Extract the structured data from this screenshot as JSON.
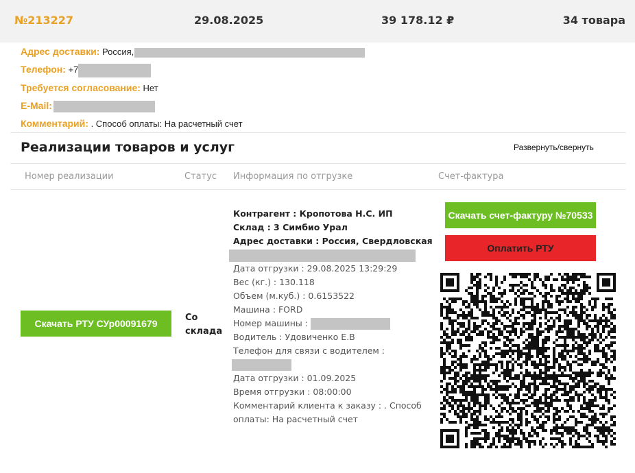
{
  "order": {
    "number": "№213227",
    "date": "29.08.2025",
    "sum": "39 178.12 ₽",
    "count": "34 товара"
  },
  "info": {
    "address_label": "Адрес доставки:",
    "address_value": "Россия,",
    "phone_label": "Телефон:",
    "phone_value": "+7",
    "approval_label": "Требуется согласование:",
    "approval_value": "Нет",
    "email_label": "E-Mail:",
    "comment_label": "Комментарий:",
    "comment_value": ". Способ оплаты: На расчетный счет"
  },
  "section": {
    "title": "Реализации товаров и услуг",
    "toggle": "Развернуть/свернуть"
  },
  "table": {
    "headers": [
      "Номер реализации",
      "Статус",
      "Информация по отгрузке",
      "Счет-фактура"
    ],
    "row": {
      "download_rtu": "Скачать РТУ СУр00091679",
      "status_line1": "Со",
      "status_line2": "склада",
      "shipment": {
        "contractor": "Контрагент : Кропотова Н.С. ИП",
        "warehouse": "Склад : 3 Симбио Урал",
        "address": "Адрес доставки : Россия, Свердловская",
        "ship_date": "Дата отгрузки : 29.08.2025 13:29:29",
        "weight": "Вес (кг.) : 130.118",
        "volume": "Объем (м.куб.) : 0.6153522",
        "car": "Машина : FORD",
        "car_number": "Номер машины :",
        "driver": "Водитель : Удовиченко Е.В",
        "driver_phone": "Телефон для связи с водителем :",
        "ship_date2": "Дата отгрузки : 01.09.2025",
        "ship_time": "Время отгрузки : 08:00:00",
        "client_comment_1": "Комментарий клиента к заказу : . Способ",
        "client_comment_2": "оплаты: На расчетный счет"
      },
      "download_invoice": "Скачать счет-фактуру №70533",
      "pay_rtu": "Оплатить РТУ"
    }
  },
  "colors": {
    "accent": "#e9a125",
    "green": "#6cbe22",
    "red": "#e8262a"
  }
}
